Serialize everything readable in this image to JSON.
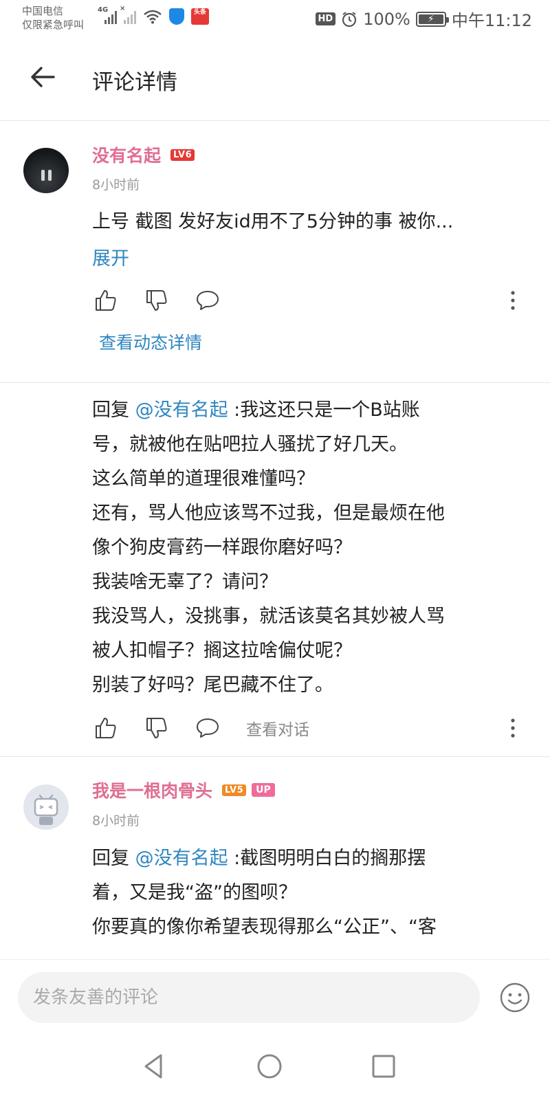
{
  "status_bar": {
    "carrier_line1": "中国电信",
    "carrier_line2": "仅限紧急呼叫",
    "signal_label": "4G",
    "news_badge_text": "头条",
    "hd_badge": "HD",
    "battery_percent": "100%",
    "battery_level": 1.0,
    "time": "中午11:12"
  },
  "header": {
    "title": "评论详情",
    "back_icon": "arrow-left-icon"
  },
  "comments": [
    {
      "username": "没有名起",
      "level_badge": "LV6",
      "time": "8小时前",
      "text_lines": [
        "上号 截图 发好友id用不了5分钟的事 被你..."
      ],
      "expand_label": "展开",
      "view_detail_label": "查看动态详情"
    },
    {
      "reply_prefix": "回复 ",
      "mention": "@没有名起",
      "first_line_rest": " :我这还只是一个B站账",
      "text_lines": [
        "号，就被他在贴吧拉人骚扰了好几天。",
        "这么简单的道理很难懂吗？",
        "还有，骂人他应该骂不过我，但是最烦在他",
        "像个狗皮膏药一样跟你磨好吗？",
        "我装啥无辜了？请问？",
        "我没骂人，没挑事，就活该莫名其妙被人骂",
        "被人扣帽子？搁这拉啥偏仗呢？",
        "别装了好吗？尾巴藏不住了。"
      ],
      "view_conversation_label": "查看对话"
    },
    {
      "username": "我是一根肉骨头",
      "level_badge": "LV5",
      "up_badge": "UP",
      "time": "8小时前",
      "reply_prefix": "回复 ",
      "mention": "@没有名起",
      "first_line_rest": " :截图明明白白的搁那摆",
      "text_lines": [
        "着，又是我“盗”的图呗？",
        "你要真的像你希望表现得那么“公正”、“客"
      ]
    }
  ],
  "input": {
    "placeholder": "发条友善的评论"
  },
  "colors": {
    "username_pink": "#e06e92",
    "link_blue": "#2e86c1",
    "level6_red": "#e53935",
    "level5_orange": "#f08a24",
    "up_pink": "#f06b9b"
  }
}
